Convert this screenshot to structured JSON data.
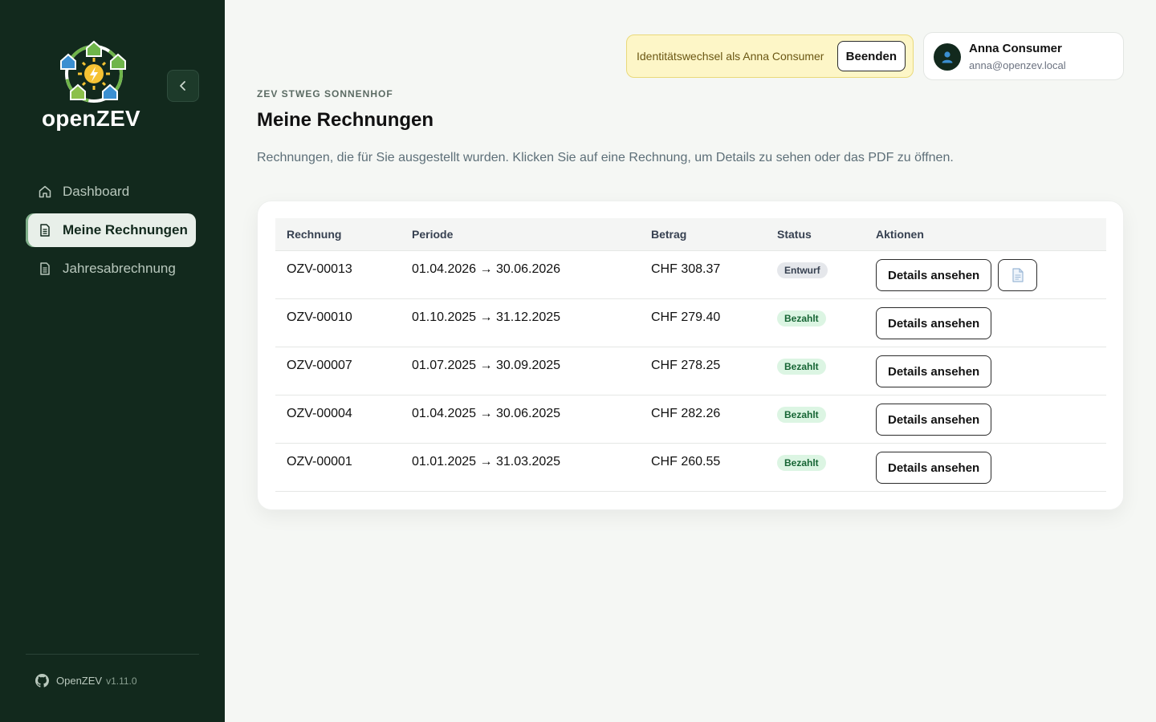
{
  "brand": {
    "name": "openZEV"
  },
  "sidebar": {
    "items": [
      {
        "label": "Dashboard",
        "icon": "home-icon"
      },
      {
        "label": "Meine Rechnungen",
        "icon": "document-icon"
      },
      {
        "label": "Jahresabrechnung",
        "icon": "document-icon"
      }
    ],
    "footer": {
      "name": "OpenZEV",
      "version": "v1.11.0"
    }
  },
  "impersonation": {
    "text": "Identitätswechsel als Anna Consumer",
    "end_label": "Beenden"
  },
  "user": {
    "name": "Anna Consumer",
    "email": "anna@openzev.local"
  },
  "header": {
    "eyebrow": "ZEV STWEG SONNENHOF",
    "title": "Meine Rechnungen",
    "subtitle": "Rechnungen, die für Sie ausgestellt wurden. Klicken Sie auf eine Rechnung, um Details zu sehen oder das PDF zu öffnen."
  },
  "table": {
    "headers": [
      "Rechnung",
      "Periode",
      "Betrag",
      "Status",
      "Aktionen"
    ],
    "details_label": "Details ansehen",
    "rows": [
      {
        "id": "OZV-00013",
        "period": "01.04.2026 → 30.06.2026",
        "amount": "CHF 308.37",
        "status": "Entwurf"
      },
      {
        "id": "OZV-00010",
        "period": "01.10.2025 → 31.12.2025",
        "amount": "CHF 279.40",
        "status": "Bezahlt"
      },
      {
        "id": "OZV-00007",
        "period": "01.07.2025 → 30.09.2025",
        "amount": "CHF 278.25",
        "status": "Bezahlt"
      },
      {
        "id": "OZV-00004",
        "period": "01.04.2025 → 30.06.2025",
        "amount": "CHF 282.26",
        "status": "Bezahlt"
      },
      {
        "id": "OZV-00001",
        "period": "01.01.2025 → 31.03.2025",
        "amount": "CHF 260.55",
        "status": "Bezahlt"
      }
    ]
  },
  "colors": {
    "sidebar": "#12291d",
    "accent": "#7fb08a",
    "badge_paid": "#dcf5e3",
    "badge_draft": "#e5e7eb"
  }
}
